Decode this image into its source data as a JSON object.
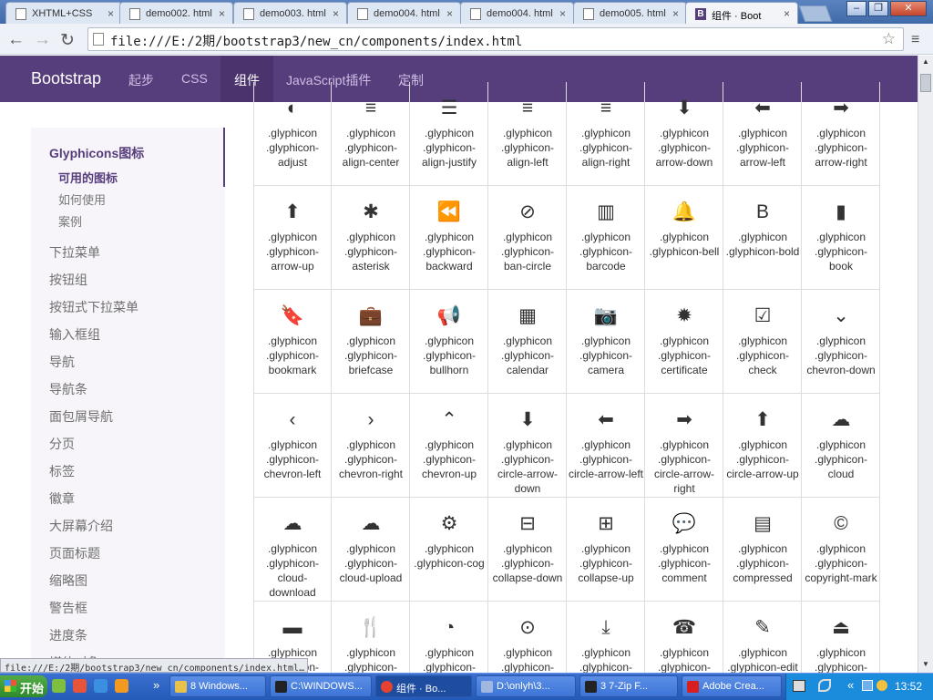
{
  "browser": {
    "tabs": [
      {
        "label": "XHTML+CSS",
        "active": false
      },
      {
        "label": "demo002. html",
        "active": false
      },
      {
        "label": "demo003. html",
        "active": false
      },
      {
        "label": "demo004. html",
        "active": false
      },
      {
        "label": "demo004. html",
        "active": false
      },
      {
        "label": "demo005. html",
        "active": false
      },
      {
        "label": "组件 · Boot",
        "active": true
      }
    ],
    "tab_close_glyph": "×",
    "window_buttons": [
      "–",
      "❐",
      "✕"
    ],
    "back_icon": "←",
    "forward_icon": "→",
    "reload_icon": "↻",
    "menu_icon": "≡",
    "star_icon": "☆",
    "address": "file:///E:/2期/bootstrap3/new_cn/components/index.html",
    "status": "file:///E:/2期/bootstrap3/new_cn/components/index.html…"
  },
  "site_nav": {
    "brand": "Bootstrap",
    "links": [
      {
        "label": "起步",
        "active": false
      },
      {
        "label": "CSS",
        "active": false
      },
      {
        "label": "组件",
        "active": true
      },
      {
        "label": "JavaScript插件",
        "active": false
      },
      {
        "label": "定制",
        "active": false
      }
    ],
    "accent": "#563d7c"
  },
  "sidebar": {
    "heading": "Glyphicons图标",
    "sub_active": "可用的图标",
    "subs": [
      "如何使用",
      "案例"
    ],
    "items": [
      "下拉菜单",
      "按钮组",
      "按钮式下拉菜单",
      "输入框组",
      "导航",
      "导航条",
      "面包屑导航",
      "分页",
      "标签",
      "徽章",
      "大屏幕介绍",
      "页面标题",
      "缩略图",
      "警告框",
      "进度条",
      "媒体对象"
    ]
  },
  "glyphs": [
    {
      "icon": "◐",
      "label": ".glyphicon .glyphicon-adjust"
    },
    {
      "icon": "≡",
      "label": ".glyphicon .glyphicon-align-center"
    },
    {
      "icon": "☰",
      "label": ".glyphicon .glyphicon-align-justify"
    },
    {
      "icon": "≡",
      "label": ".glyphicon .glyphicon-align-left"
    },
    {
      "icon": "≡",
      "label": ".glyphicon .glyphicon-align-right"
    },
    {
      "icon": "⬇",
      "label": ".glyphicon .glyphicon-arrow-down"
    },
    {
      "icon": "⬅",
      "label": ".glyphicon .glyphicon-arrow-left"
    },
    {
      "icon": "➡",
      "label": ".glyphicon .glyphicon-arrow-right"
    },
    {
      "icon": "⬆",
      "label": ".glyphicon .glyphicon-arrow-up"
    },
    {
      "icon": "✱",
      "label": ".glyphicon .glyphicon-asterisk"
    },
    {
      "icon": "⏪",
      "label": ".glyphicon .glyphicon-backward"
    },
    {
      "icon": "⊘",
      "label": ".glyphicon .glyphicon-ban-circle"
    },
    {
      "icon": "▥",
      "label": ".glyphicon .glyphicon-barcode"
    },
    {
      "icon": "🔔",
      "label": ".glyphicon .glyphicon-bell"
    },
    {
      "icon": "B",
      "label": ".glyphicon .glyphicon-bold"
    },
    {
      "icon": "▮",
      "label": ".glyphicon .glyphicon-book"
    },
    {
      "icon": "🔖",
      "label": ".glyphicon .glyphicon-bookmark"
    },
    {
      "icon": "💼",
      "label": ".glyphicon .glyphicon-briefcase"
    },
    {
      "icon": "📢",
      "label": ".glyphicon .glyphicon-bullhorn"
    },
    {
      "icon": "▦",
      "label": ".glyphicon .glyphicon-calendar"
    },
    {
      "icon": "📷",
      "label": ".glyphicon .glyphicon-camera"
    },
    {
      "icon": "✹",
      "label": ".glyphicon .glyphicon-certificate"
    },
    {
      "icon": "☑",
      "label": ".glyphicon .glyphicon-check"
    },
    {
      "icon": "⌄",
      "label": ".glyphicon .glyphicon-chevron-down"
    },
    {
      "icon": "‹",
      "label": ".glyphicon .glyphicon-chevron-left"
    },
    {
      "icon": "›",
      "label": ".glyphicon .glyphicon-chevron-right"
    },
    {
      "icon": "⌃",
      "label": ".glyphicon .glyphicon-chevron-up"
    },
    {
      "icon": "⬇",
      "label": ".glyphicon .glyphicon-circle-arrow-down"
    },
    {
      "icon": "⬅",
      "label": ".glyphicon .glyphicon-circle-arrow-left"
    },
    {
      "icon": "➡",
      "label": ".glyphicon .glyphicon-circle-arrow-right"
    },
    {
      "icon": "⬆",
      "label": ".glyphicon .glyphicon-circle-arrow-up"
    },
    {
      "icon": "☁",
      "label": ".glyphicon .glyphicon-cloud"
    },
    {
      "icon": "☁",
      "label": ".glyphicon .glyphicon-cloud-download"
    },
    {
      "icon": "☁",
      "label": ".glyphicon .glyphicon-cloud-upload"
    },
    {
      "icon": "⚙",
      "label": ".glyphicon .glyphicon-cog"
    },
    {
      "icon": "⊟",
      "label": ".glyphicon .glyphicon-collapse-down"
    },
    {
      "icon": "⊞",
      "label": ".glyphicon .glyphicon-collapse-up"
    },
    {
      "icon": "💬",
      "label": ".glyphicon .glyphicon-comment"
    },
    {
      "icon": "▤",
      "label": ".glyphicon .glyphicon-compressed"
    },
    {
      "icon": "©",
      "label": ".glyphicon .glyphicon-copyright-mark"
    },
    {
      "icon": "▬",
      "label": ".glyphicon .glyphicon-credit-card"
    },
    {
      "icon": "🍴",
      "label": ".glyphicon .glyphicon-cutlery"
    },
    {
      "icon": "◔",
      "label": ".glyphicon .glyphicon-dashboard"
    },
    {
      "icon": "⊙",
      "label": ".glyphicon .glyphicon-download"
    },
    {
      "icon": "⤓",
      "label": ".glyphicon .glyphicon-download-alt"
    },
    {
      "icon": "☎",
      "label": ".glyphicon .glyphicon-earphone"
    },
    {
      "icon": "✎",
      "label": ".glyphicon .glyphicon-edit"
    },
    {
      "icon": "⏏",
      "label": ".glyphicon .glyphicon-eject"
    }
  ],
  "taskbar": {
    "start": "开始",
    "tasks": [
      {
        "label": "8 Windows...",
        "color": "#e8c14a"
      },
      {
        "label": "C:\\WINDOWS...",
        "color": "#222222"
      },
      {
        "label": "组件 · Bo...",
        "color": "#e7422f",
        "active": true
      },
      {
        "label": "D:\\onlyh\\3...",
        "color": "#a0b8e0"
      },
      {
        "label": "3 7-Zip F...",
        "color": "#222222"
      },
      {
        "label": "Adobe Crea...",
        "color": "#d81e1e"
      }
    ],
    "clock": "13:52"
  }
}
